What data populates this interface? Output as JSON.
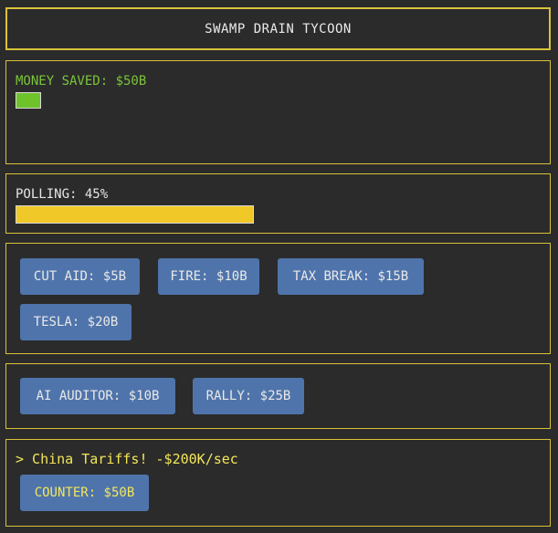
{
  "title": "SWAMP DRAIN TYCOON",
  "money": {
    "label": "MONEY SAVED: $50B",
    "bar_color": "#6ec32a"
  },
  "polling": {
    "label": "POLLING: 45%",
    "value_percent": 45,
    "bar_color": "#f0c928"
  },
  "actions": [
    {
      "label": "CUT AID: $5B"
    },
    {
      "label": "FIRE: $10B"
    },
    {
      "label": "TAX BREAK: $15B"
    },
    {
      "label": "TESLA: $20B"
    }
  ],
  "tools": [
    {
      "label": "AI AUDITOR: $10B"
    },
    {
      "label": "RALLY: $25B"
    }
  ],
  "event": {
    "text": "> China Tariffs! -$200K/sec",
    "counter_label": "COUNTER: $50B"
  },
  "colors": {
    "background": "#2b2b2b",
    "border": "#d9c23a",
    "button": "#4f74ab",
    "money_text": "#7ac43a",
    "event_text": "#f3e65a"
  }
}
